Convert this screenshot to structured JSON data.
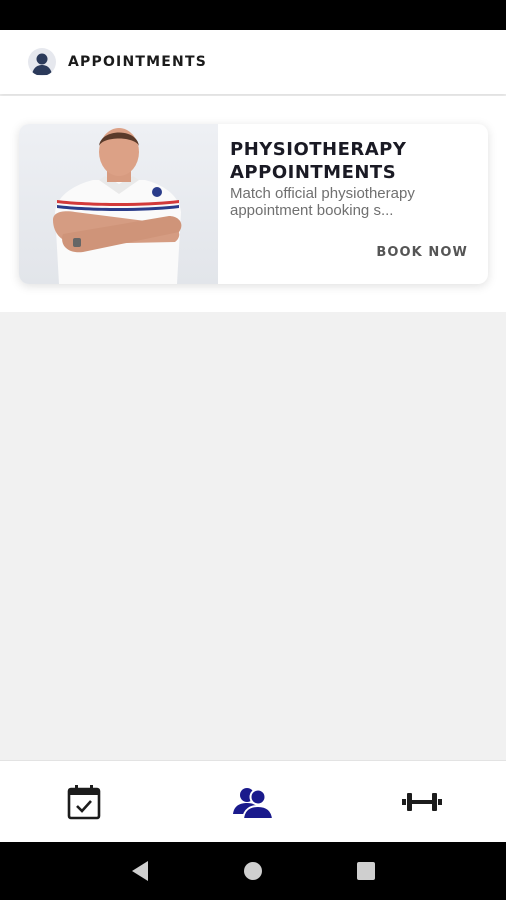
{
  "header": {
    "title": "APPOINTMENTS",
    "avatar_icon": "person-avatar-icon"
  },
  "card": {
    "title_line1": "PHYSIOTHERAPY",
    "title_line2": "APPOINTMENTS",
    "description_line1": "Match official physiotherapy",
    "description_line2": "appointment booking s...",
    "action_label": "BOOK NOW",
    "image": "physiotherapist-photo"
  },
  "bottom_nav": {
    "items": [
      {
        "icon": "calendar-check-icon",
        "active": false
      },
      {
        "icon": "people-icon",
        "active": true
      },
      {
        "icon": "dumbbell-icon",
        "active": false
      }
    ],
    "active_color": "#1a1a8c",
    "inactive_color": "#1c1c1c"
  },
  "system_nav": {
    "items": [
      "back-icon",
      "home-icon",
      "recents-icon"
    ]
  }
}
